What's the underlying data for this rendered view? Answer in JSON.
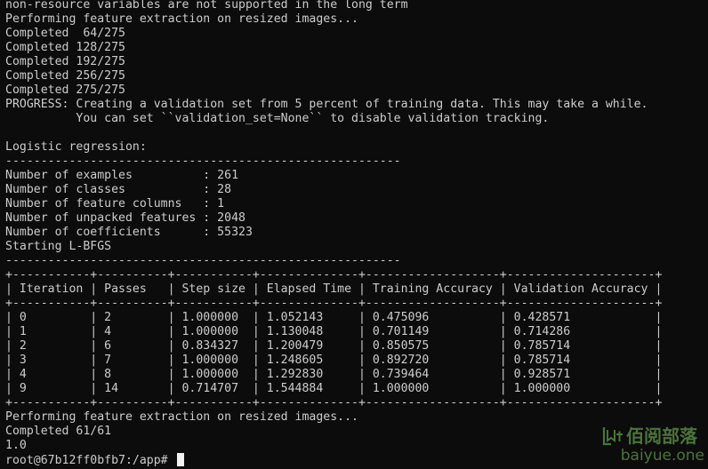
{
  "terminal": {
    "lines": [
      "non-resource variables are not supported in the long term",
      "Performing feature extraction on resized images...",
      "Completed  64/275",
      "Completed 128/275",
      "Completed 192/275",
      "Completed 256/275",
      "Completed 275/275",
      "PROGRESS: Creating a validation set from 5 percent of training data. This may take a while.",
      "          You can set ``validation_set=None`` to disable validation tracking.",
      "",
      "Logistic regression:",
      "--------------------------------------------------------",
      "Number of examples          : 261",
      "Number of classes           : 28",
      "Number of feature columns   : 1",
      "Number of unpacked features : 2048",
      "Number of coefficients      : 55323",
      "Starting L-BFGS",
      "--------------------------------------------------------",
      "+-----------+----------+-----------+--------------+-------------------+---------------------+",
      "| Iteration | Passes   | Step size | Elapsed Time | Training Accuracy | Validation Accuracy |",
      "+-----------+----------+-----------+--------------+-------------------+---------------------+",
      "| 0         | 2        | 1.000000  | 1.052143     | 0.475096          | 0.428571            |",
      "| 1         | 4        | 1.000000  | 1.130048     | 0.701149          | 0.714286            |",
      "| 2         | 6        | 0.834327  | 1.200479     | 0.850575          | 0.785714            |",
      "| 3         | 7        | 1.000000  | 1.248605     | 0.892720          | 0.785714            |",
      "| 4         | 8        | 1.000000  | 1.292830     | 0.739464          | 0.928571            |",
      "| 9         | 14       | 0.714707  | 1.544884     | 1.000000          | 1.000000            |",
      "+-----------+----------+-----------+--------------+-------------------+---------------------+",
      "Performing feature extraction on resized images...",
      "Completed 61/61",
      "1.0"
    ],
    "prompt": "root@67b12ff0bfb7:/app# "
  },
  "watermark": {
    "chinese": "佰阅部落",
    "domain": "baiyue.one"
  },
  "colors": {
    "background": "#0c0c0c",
    "foreground": "#cccccc",
    "watermark": "#4f7a3c"
  }
}
